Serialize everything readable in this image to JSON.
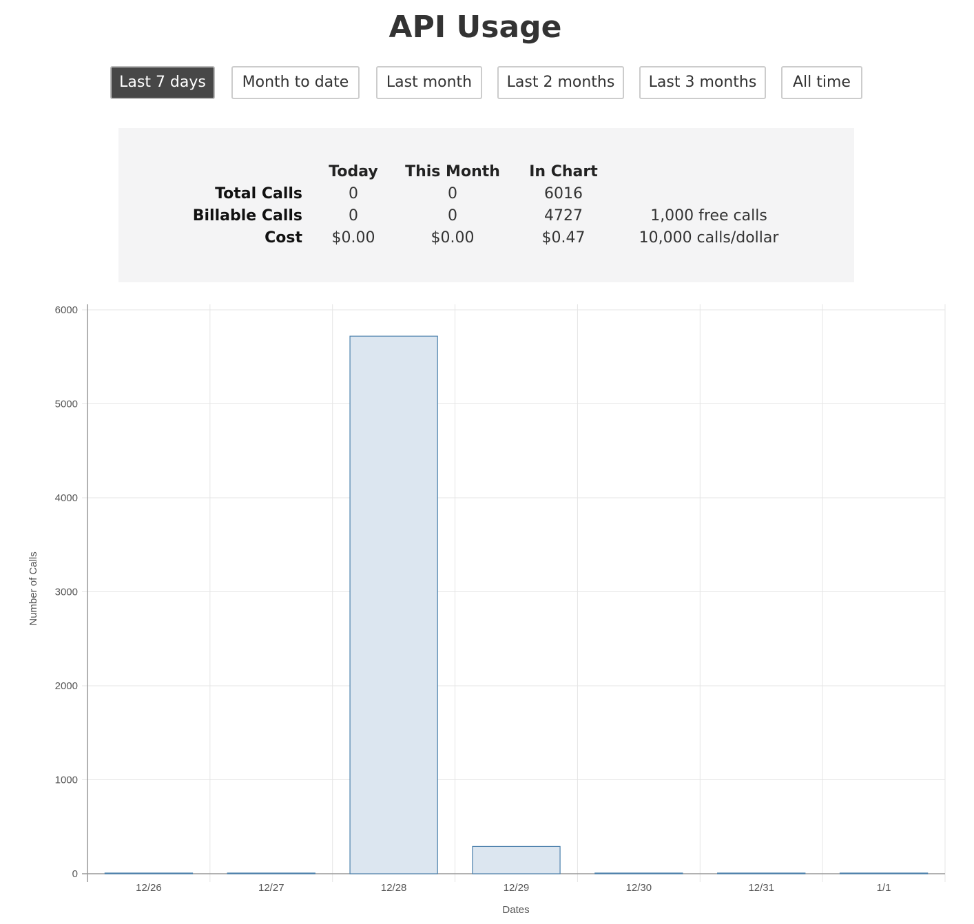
{
  "page": {
    "title": "API Usage"
  },
  "range_buttons": [
    {
      "label": "Last 7 days",
      "active": true
    },
    {
      "label": "Month to date",
      "active": false
    },
    {
      "label": "Last month",
      "active": false
    },
    {
      "label": "Last 2 months",
      "active": false
    },
    {
      "label": "Last 3 months",
      "active": false
    },
    {
      "label": "All time",
      "active": false
    }
  ],
  "summary": {
    "columns": [
      "Today",
      "This Month",
      "In Chart"
    ],
    "rows": [
      {
        "label": "Total Calls",
        "values": [
          "0",
          "0",
          "6016"
        ],
        "note": ""
      },
      {
        "label": "Billable Calls",
        "values": [
          "0",
          "0",
          "4727"
        ],
        "note": "1,000 free calls"
      },
      {
        "label": "Cost",
        "values": [
          "$0.00",
          "$0.00",
          "$0.47"
        ],
        "note": "10,000 calls/dollar"
      }
    ]
  },
  "colors": {
    "active_button": "#474747",
    "panel_bg": "#f4f4f5",
    "bar_fill": "#dce6f0",
    "bar_stroke": "#4a7fab",
    "grid": "#e5e5e5"
  },
  "chart_data": {
    "type": "bar",
    "title": "",
    "xlabel": "Dates",
    "ylabel": "Number of Calls",
    "categories": [
      "12/26",
      "12/27",
      "12/28",
      "12/29",
      "12/30",
      "12/31",
      "1/1"
    ],
    "values": [
      0,
      0,
      5720,
      290,
      0,
      0,
      0
    ],
    "ylim": [
      0,
      6000
    ],
    "yticks": [
      0,
      1000,
      2000,
      3000,
      4000,
      5000,
      6000
    ],
    "grid": true,
    "legend": "none"
  }
}
